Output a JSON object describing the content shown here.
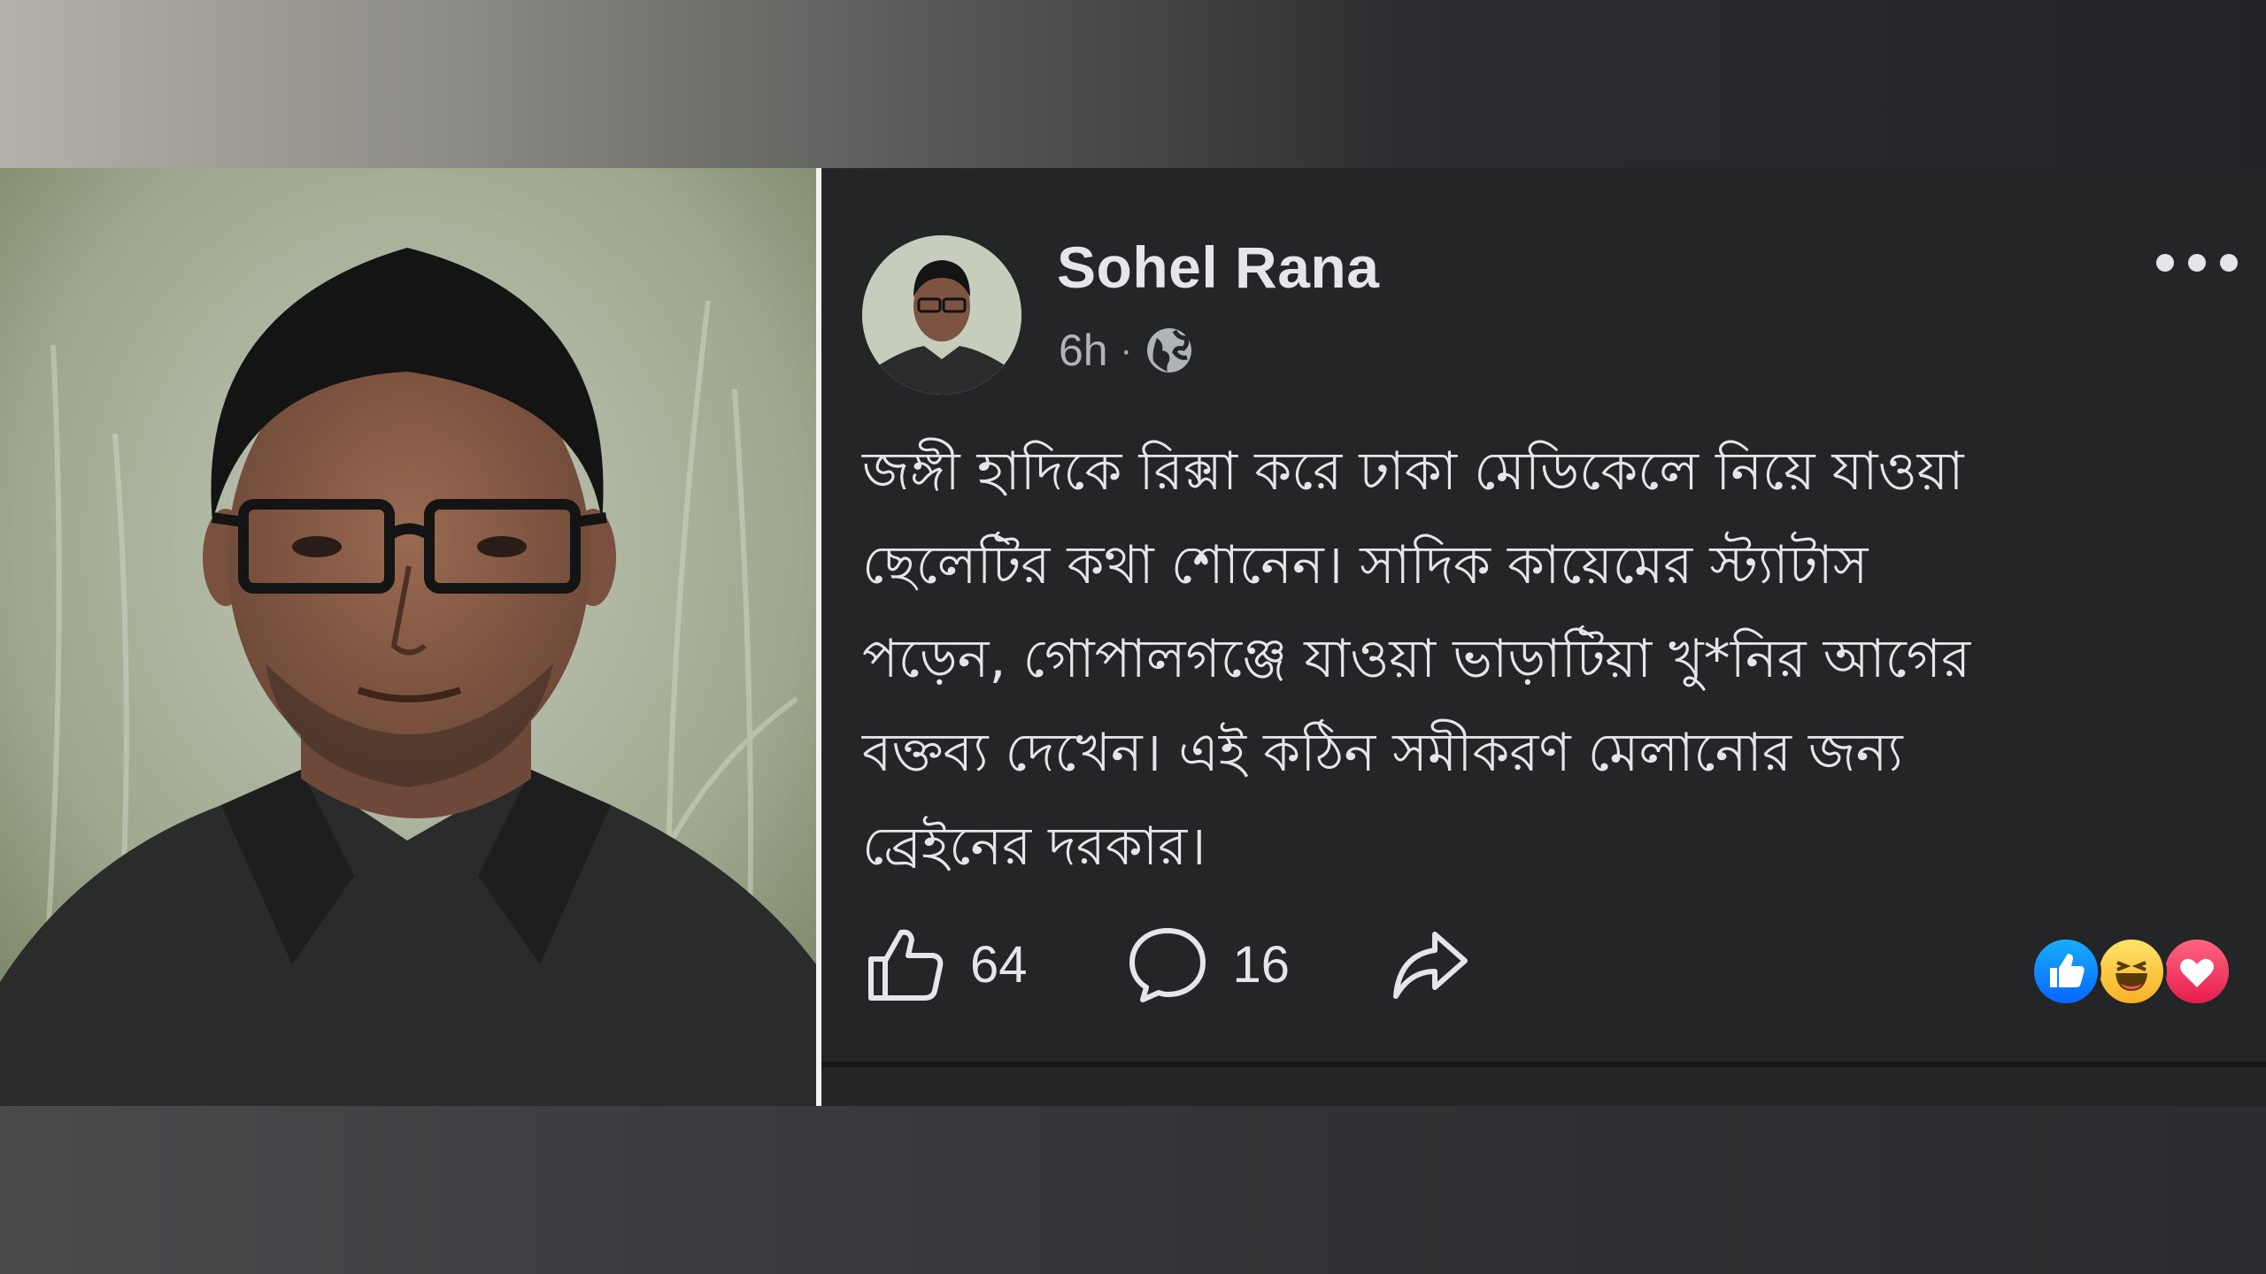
{
  "post": {
    "author": "Sohel Rana",
    "time": "6h",
    "separator": "·",
    "visibility_icon": "globe-icon",
    "more_icon": "more-options-icon",
    "text_lines": [
      "জঙ্গী হাদিকে রিক্সা করে ঢাকা মেডিকেলে নিয়ে যাওয়া",
      "ছেলেটির কথা শোনেন। সাদিক কায়েমের স্ট্যাটাস",
      "পড়েন, গোপালগঞ্জে যাওয়া ভাড়াটিয়া খু*নির আগের",
      "বক্তব্য দেখেন। এই কঠিন সমীকরণ মেলানোর জন্য",
      "ব্রেইনের দরকার।"
    ],
    "actions": {
      "like_count": "64",
      "comment_count": "16",
      "share_icon": "share-icon"
    },
    "reactions": [
      "like",
      "haha",
      "love"
    ]
  },
  "colors": {
    "card_bg": "#242526",
    "text": "#e4e6eb",
    "secondary_text": "#b0b3b8",
    "like_blue": "#0866ff",
    "love_red": "#e61e4d",
    "haha_yellow": "#f7b125"
  }
}
